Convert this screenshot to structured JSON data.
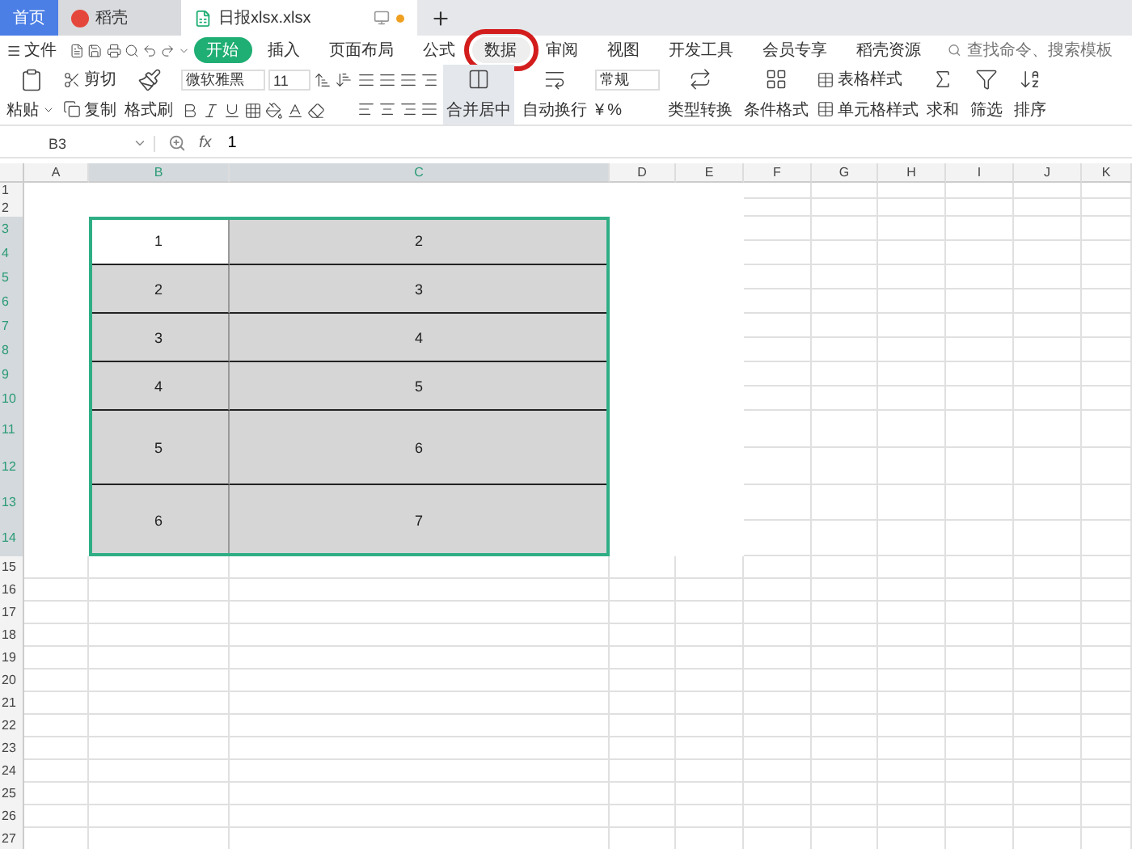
{
  "tabs": [
    {
      "label": "首页",
      "kind": "home",
      "selected": false
    },
    {
      "label": "稻壳",
      "kind": "docer",
      "selected": false
    },
    {
      "label": "日报xlsx.xlsx",
      "kind": "sheet",
      "selected": true
    }
  ],
  "menu": {
    "file": "文件",
    "items": [
      {
        "label": "开始",
        "selected": true,
        "annotated": false
      },
      {
        "label": "插入",
        "selected": false,
        "annotated": false
      },
      {
        "label": "页面布局",
        "selected": false,
        "annotated": false
      },
      {
        "label": "公式",
        "selected": false,
        "annotated": false
      },
      {
        "label": "数据",
        "selected": false,
        "annotated": true
      },
      {
        "label": "审阅",
        "selected": false,
        "annotated": false
      },
      {
        "label": "视图",
        "selected": false,
        "annotated": false
      },
      {
        "label": "开发工具",
        "selected": false,
        "annotated": false
      },
      {
        "label": "会员专享",
        "selected": false,
        "annotated": false
      },
      {
        "label": "稻壳资源",
        "selected": false,
        "annotated": false
      }
    ],
    "search": {
      "placeholder": "查找命令、搜索模板"
    }
  },
  "ribbon": {
    "paste": "粘贴",
    "cut": "剪切",
    "copy": "复制",
    "format_painter": "格式刷",
    "font": "微软雅黑",
    "font_size": "11",
    "merge_center": {
      "label": "合并居中",
      "selected": true
    },
    "wrap_text": "自动换行",
    "number_format": "常规",
    "currency": "¥",
    "percent": "%",
    "type_convert": "类型转换",
    "conditional_format": "条件格式",
    "table_style": "表格样式",
    "cell_style": "单元格样式",
    "sum": "求和",
    "filter": "筛选",
    "sort": "排序"
  },
  "formula_bar": {
    "cell": "B3",
    "fx": "fx",
    "value": "1"
  },
  "sheet": {
    "columns": [
      {
        "label": "A",
        "selected": false
      },
      {
        "label": "B",
        "selected": true
      },
      {
        "label": "C",
        "selected": true
      },
      {
        "label": "D",
        "selected": false
      },
      {
        "label": "E",
        "selected": false
      },
      {
        "label": "F",
        "selected": false
      },
      {
        "label": "G",
        "selected": false
      },
      {
        "label": "H",
        "selected": false
      },
      {
        "label": "I",
        "selected": false
      },
      {
        "label": "J",
        "selected": false
      },
      {
        "label": "K",
        "selected": false
      }
    ],
    "rows": [
      {
        "label": "1",
        "selected": false
      },
      {
        "label": "2",
        "selected": false
      },
      {
        "label": "3",
        "selected": true
      },
      {
        "label": "4",
        "selected": true
      },
      {
        "label": "5",
        "selected": true
      },
      {
        "label": "6",
        "selected": true
      },
      {
        "label": "7",
        "selected": true
      },
      {
        "label": "8",
        "selected": true
      },
      {
        "label": "9",
        "selected": true
      },
      {
        "label": "10",
        "selected": true
      },
      {
        "label": "11",
        "selected": true
      },
      {
        "label": "12",
        "selected": true
      },
      {
        "label": "13",
        "selected": true
      },
      {
        "label": "14",
        "selected": true
      },
      {
        "label": "15",
        "selected": false
      },
      {
        "label": "16",
        "selected": false
      },
      {
        "label": "17",
        "selected": false
      },
      {
        "label": "18",
        "selected": false
      },
      {
        "label": "19",
        "selected": false
      },
      {
        "label": "20",
        "selected": false
      },
      {
        "label": "21",
        "selected": false
      },
      {
        "label": "22",
        "selected": false
      },
      {
        "label": "23",
        "selected": false
      },
      {
        "label": "24",
        "selected": false
      },
      {
        "label": "25",
        "selected": false
      },
      {
        "label": "26",
        "selected": false
      },
      {
        "label": "27",
        "selected": false
      }
    ],
    "table": [
      {
        "b": {
          "value": "1",
          "active": true
        },
        "c": {
          "value": "2",
          "active": false
        }
      },
      {
        "b": {
          "value": "2",
          "active": false
        },
        "c": {
          "value": "3",
          "active": false
        }
      },
      {
        "b": {
          "value": "3",
          "active": false
        },
        "c": {
          "value": "4",
          "active": false
        }
      },
      {
        "b": {
          "value": "4",
          "active": false
        },
        "c": {
          "value": "5",
          "active": false
        }
      },
      {
        "b": {
          "value": "5",
          "active": false
        },
        "c": {
          "value": "6",
          "active": false
        }
      },
      {
        "b": {
          "value": "6",
          "active": false
        },
        "c": {
          "value": "7",
          "active": false
        }
      }
    ]
  }
}
